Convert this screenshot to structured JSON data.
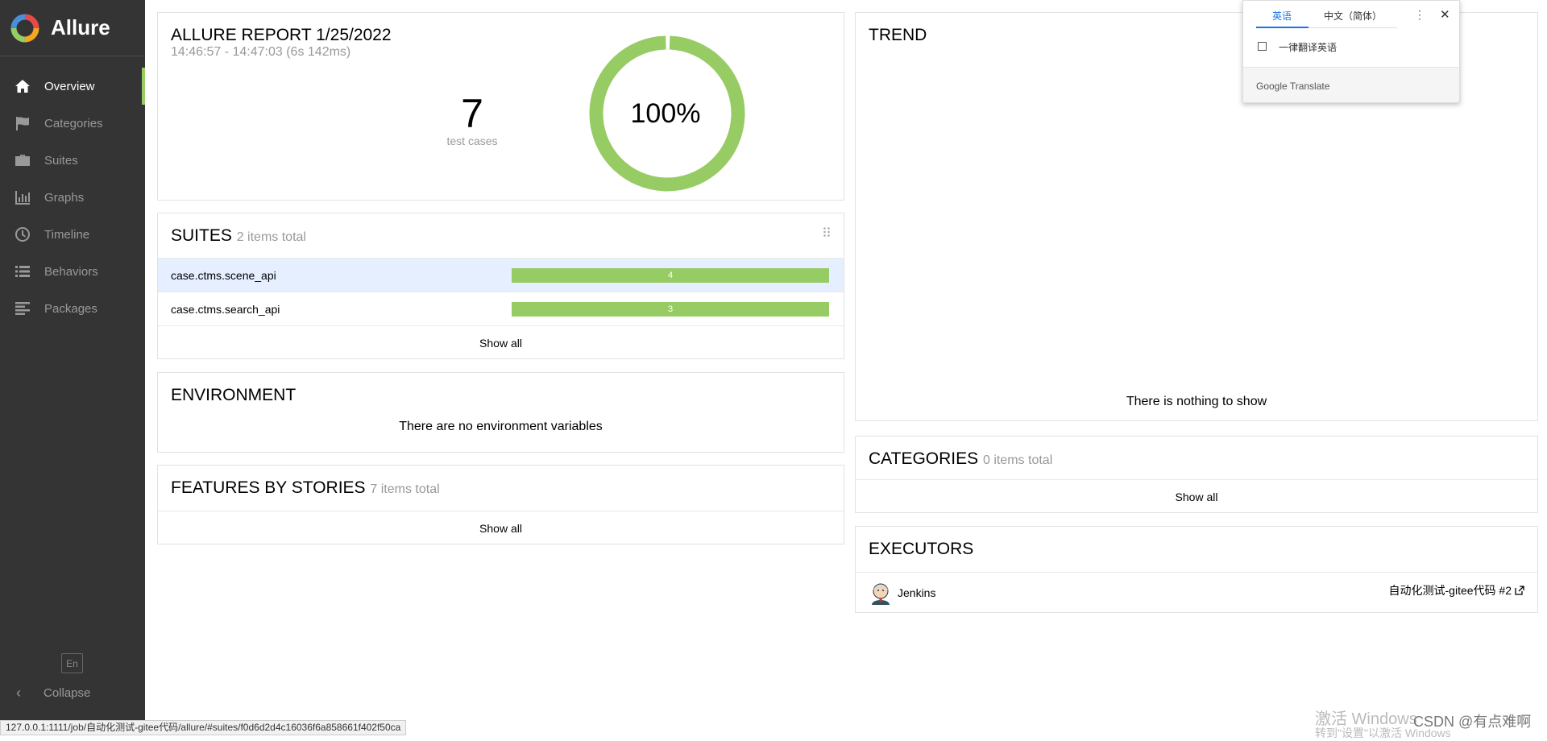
{
  "app": {
    "name": "Allure"
  },
  "sidebar": {
    "items": [
      {
        "label": "Overview",
        "icon": "home-icon",
        "active": true
      },
      {
        "label": "Categories",
        "icon": "flag-icon",
        "active": false
      },
      {
        "label": "Suites",
        "icon": "briefcase-icon",
        "active": false
      },
      {
        "label": "Graphs",
        "icon": "bar-chart-icon",
        "active": false
      },
      {
        "label": "Timeline",
        "icon": "clock-icon",
        "active": false
      },
      {
        "label": "Behaviors",
        "icon": "list-icon",
        "active": false
      },
      {
        "label": "Packages",
        "icon": "align-left-icon",
        "active": false
      }
    ],
    "language": "En",
    "collapse_label": "Collapse"
  },
  "summary": {
    "title": "ALLURE REPORT 1/25/2022",
    "time_range": "14:46:57 - 14:47:03 (6s 142ms)",
    "test_count": "7",
    "test_count_label": "test cases",
    "success_rate": "100%",
    "success_fraction": 1.0
  },
  "suites": {
    "title": "SUITES",
    "subtitle": "2 items total",
    "rows": [
      {
        "name": "case.ctms.scene_api",
        "count": "4"
      },
      {
        "name": "case.ctms.search_api",
        "count": "3"
      }
    ],
    "show_all": "Show all"
  },
  "environment": {
    "title": "ENVIRONMENT",
    "message": "There are no environment variables"
  },
  "features": {
    "title": "FEATURES BY STORIES",
    "subtitle": "7 items total",
    "show_all": "Show all"
  },
  "trend": {
    "title": "TREND",
    "message": "There is nothing to show"
  },
  "categories": {
    "title": "CATEGORIES",
    "subtitle": "0 items total",
    "show_all": "Show all"
  },
  "executors": {
    "title": "EXECUTORS",
    "name": "Jenkins",
    "build": "自动化测试-gitee代码 #2"
  },
  "translate_popup": {
    "tab_source": "英语",
    "tab_target": "中文（简体）",
    "always_translate": "一律翻译英语",
    "brand": "Google Translate"
  },
  "status_url": "127.0.0.1:1111/job/自动化测试-gitee代码/allure/#suites/f0d6d2d4c16036f6a858661f402f50ca",
  "watermark": {
    "activate": "激活 Windows",
    "activate_sub": "转到\"设置\"以激活 Windows",
    "csdn": "CSDN @有点难啊"
  },
  "colors": {
    "passed": "#97cc64",
    "sidebar_bg": "#343434",
    "highlight_row": "#e5efff"
  }
}
